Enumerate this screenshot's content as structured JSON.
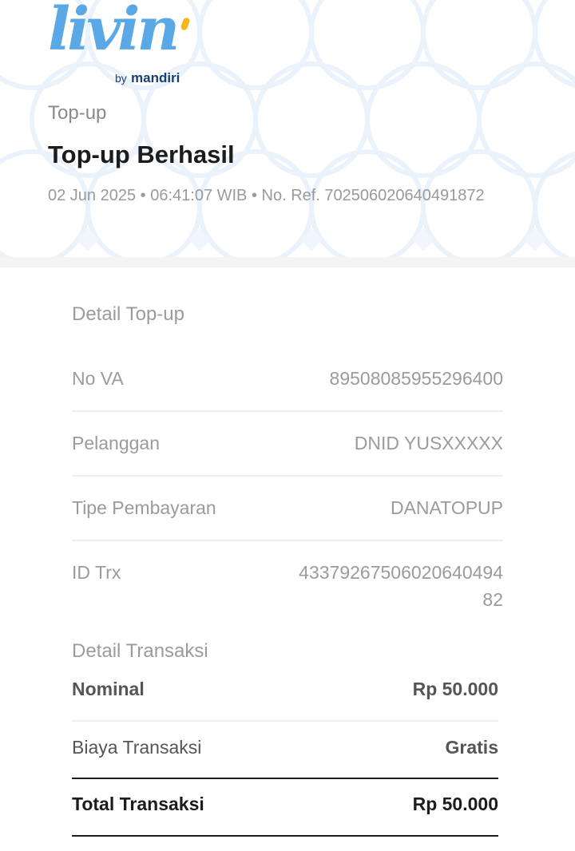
{
  "brand": {
    "logo_script": "livin",
    "by": "by",
    "name": "mandiri"
  },
  "header": {
    "category": "Top-up",
    "title": "Top-up Berhasil",
    "meta": "02 Jun 2025 • 06:41:07 WIB • No. Ref. 702506020640491872"
  },
  "detail": {
    "label": "Detail Top-up",
    "rows": [
      {
        "key": "No VA",
        "value": "89508085955296400"
      },
      {
        "key": "Pelanggan",
        "value": "DNID YUSXXXXX"
      },
      {
        "key": "Tipe Pembayaran",
        "value": "DANATOPUP"
      },
      {
        "key": "ID Trx",
        "value_line1": "43379267506020640494",
        "value_line2": "82"
      }
    ]
  },
  "transaction": {
    "label": "Detail Transaksi",
    "nominal_label": "Nominal",
    "nominal_value": "Rp 50.000",
    "fee_label": "Biaya Transaksi",
    "fee_value": "Gratis",
    "total_label": "Total Transaksi",
    "total_value": "Rp 50.000"
  },
  "colors": {
    "brand_blue": "#5aa9e6",
    "brand_navy": "#1a3f73",
    "accent_yellow": "#f5b61b"
  }
}
